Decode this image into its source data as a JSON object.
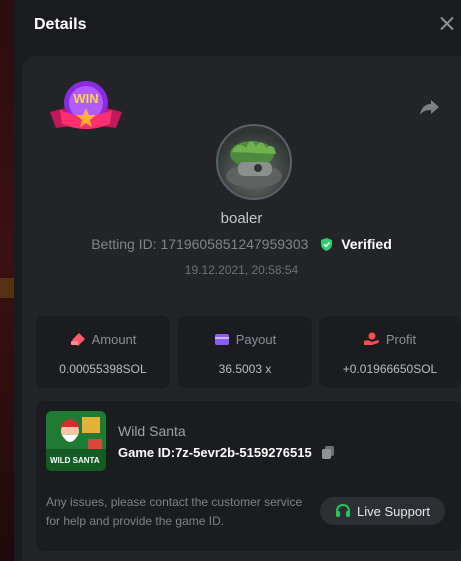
{
  "modal": {
    "title": "Details"
  },
  "player": {
    "username": "boaler",
    "betting_id_label": "Betting ID:",
    "betting_id": "1719605851247959303",
    "verified_label": "Verified",
    "date": "19.12.2021, 20:58:54",
    "badge_text": "WIN"
  },
  "stats": {
    "amount": {
      "label": "Amount",
      "value": "0.00055398SOL",
      "icon": "amount-icon",
      "color": "#ff5a6b"
    },
    "payout": {
      "label": "Payout",
      "value": "36.5003 x",
      "icon": "wallet-icon",
      "color": "#8b5cf6"
    },
    "profit": {
      "label": "Profit",
      "value": "+0.01966650SOL",
      "icon": "profit-icon",
      "color": "#ff4d4d"
    }
  },
  "game": {
    "name": "Wild Santa",
    "id_label": "Game ID:",
    "id": "7z-5evr2b-5159276515",
    "thumb_text": "WILD SANTA"
  },
  "support": {
    "notice": "Any issues, please contact the customer service for help and provide the game ID.",
    "button_label": "Live Support"
  },
  "colors": {
    "verified": "#2ecc71",
    "support_icon": "#22c55e"
  }
}
